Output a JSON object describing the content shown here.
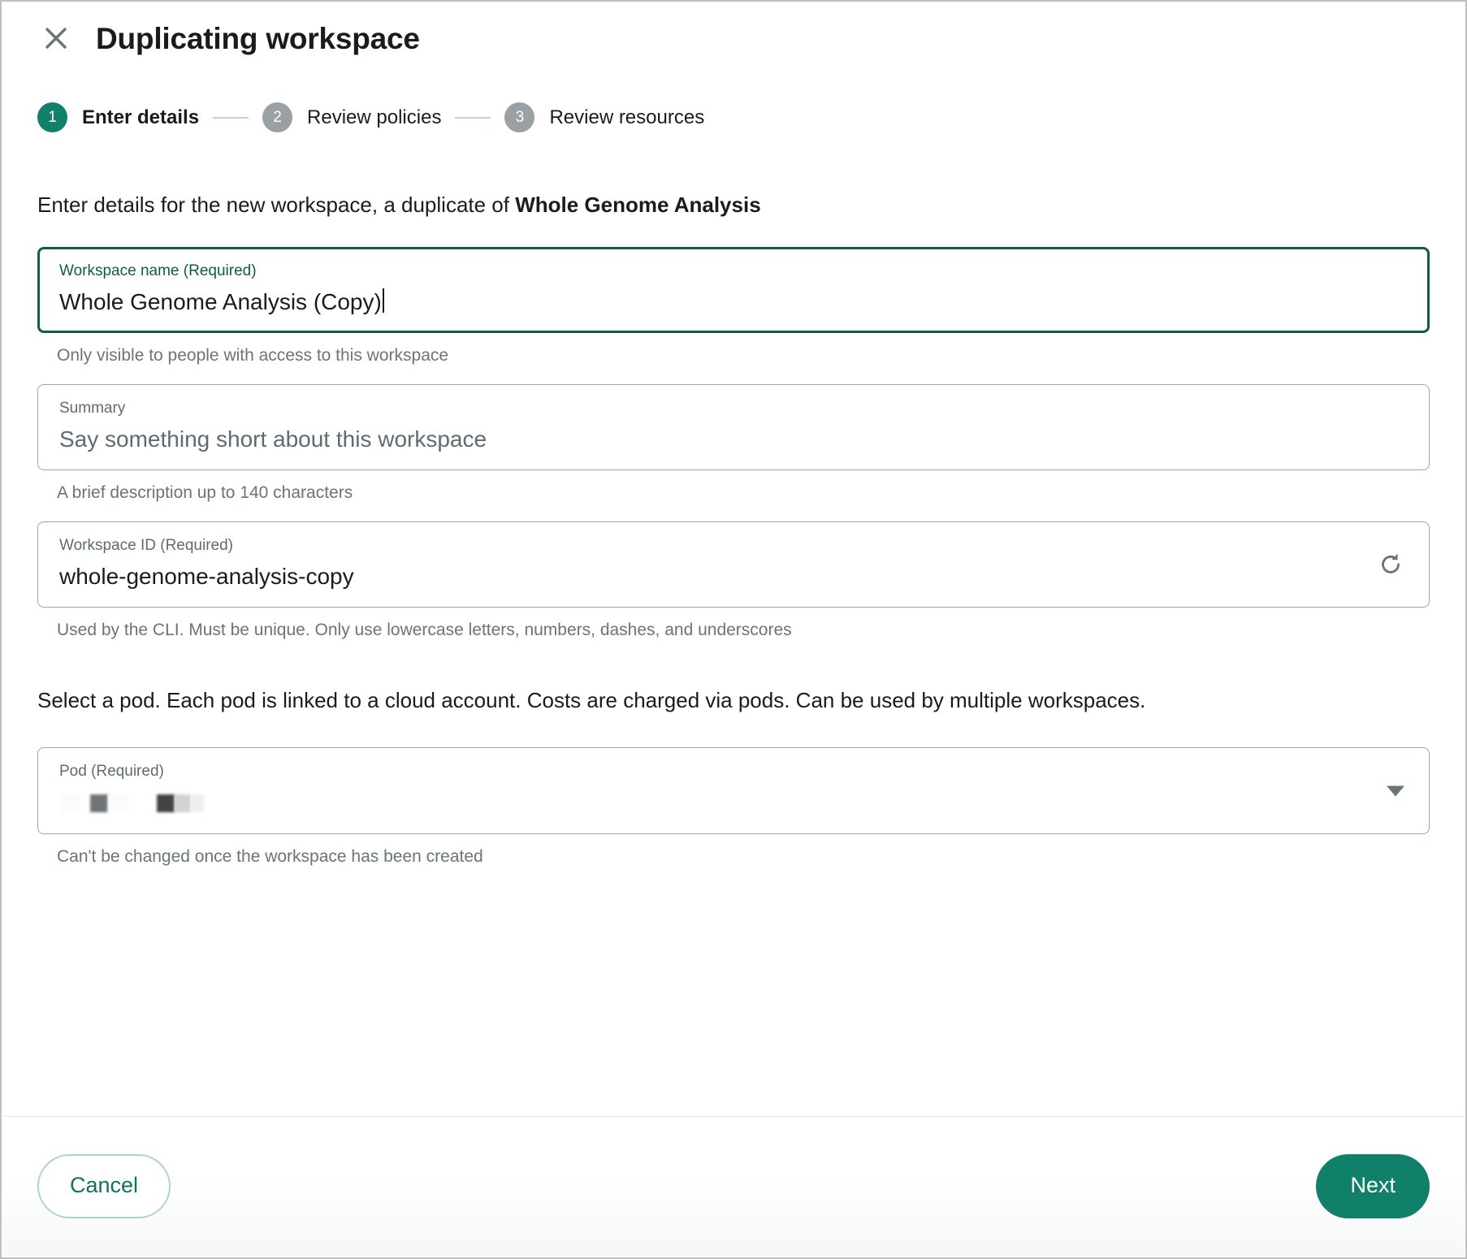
{
  "dialog": {
    "title": "Duplicating workspace",
    "close_icon": "close-icon"
  },
  "stepper": {
    "steps": [
      {
        "number": "1",
        "label": "Enter details",
        "state": "active"
      },
      {
        "number": "2",
        "label": "Review policies",
        "state": "inactive"
      },
      {
        "number": "3",
        "label": "Review resources",
        "state": "inactive"
      }
    ]
  },
  "intro": {
    "prefix": "Enter details for the new workspace, a duplicate of ",
    "source_workspace": "Whole Genome Analysis"
  },
  "fields": {
    "workspace_name": {
      "label": "Workspace name (Required)",
      "value": "Whole Genome Analysis (Copy)",
      "helper": "Only visible to people with access to this workspace",
      "focused": true
    },
    "summary": {
      "label": "Summary",
      "value": "",
      "placeholder": "Say something short about this workspace",
      "helper": "A brief description up to 140 characters",
      "focused": false
    },
    "workspace_id": {
      "label": "Workspace ID (Required)",
      "value": "whole-genome-analysis-copy",
      "helper": "Used by the CLI. Must be unique. Only use lowercase letters, numbers, dashes, and underscores",
      "action_icon": "refresh-icon",
      "focused": false
    },
    "pod": {
      "label": "Pod (Required)",
      "value_redacted": true,
      "helper": "Can't be changed once the workspace has been created",
      "caret_icon": "chevron-down-icon"
    }
  },
  "pod_section": {
    "text": "Select a pod. Each pod is linked to a cloud account. Costs are charged via pods. Can be used by multiple workspaces."
  },
  "footer": {
    "cancel_label": "Cancel",
    "next_label": "Next"
  },
  "colors": {
    "accent": "#11806a",
    "accent_dark": "#0f5c4f",
    "accent_soft_border": "#aed3cb",
    "inactive_step": "#9aa0a3",
    "border": "#9aa5b1",
    "muted_text": "#6b7478"
  }
}
